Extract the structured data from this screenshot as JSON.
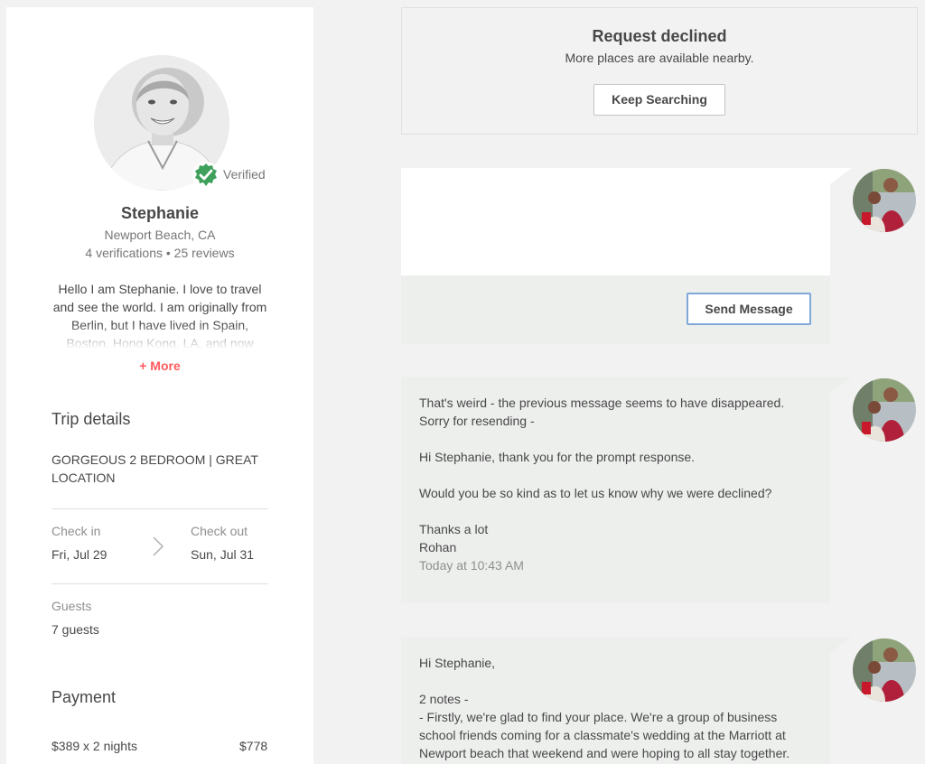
{
  "host": {
    "name": "Stephanie",
    "verified_label": "Verified",
    "location": "Newport Beach, CA",
    "stats": "4 verifications • 25 reviews",
    "bio": "Hello I am Stephanie. I love to travel and see the world. I am originally from Berlin, but I have lived in Spain, Boston, Hong Kong, LA, and now",
    "more_label": "+ More"
  },
  "trip": {
    "title": "Trip details",
    "listing_name": "GORGEOUS 2 BEDROOM | GREAT LOCATION",
    "checkin_label": "Check in",
    "checkin_value": "Fri, Jul 29",
    "checkout_label": "Check out",
    "checkout_value": "Sun, Jul 31",
    "guests_label": "Guests",
    "guests_value": "7 guests"
  },
  "payment": {
    "title": "Payment",
    "line_label": "$389 x 2 nights",
    "line_amount": "$778"
  },
  "status": {
    "title": "Request declined",
    "subtitle": "More places are available nearby.",
    "button_label": "Keep Searching"
  },
  "compose": {
    "value": "",
    "send_label": "Send Message"
  },
  "messages": [
    {
      "lines": [
        "That's weird - the previous message seems to have disappeared.",
        "Sorry for resending -",
        "",
        "Hi Stephanie, thank you for the prompt response.",
        "",
        "Would you be so kind as to let us know why we were declined?",
        "",
        "Thanks a lot",
        "Rohan"
      ],
      "time": "Today at 10:43 AM"
    },
    {
      "lines": [
        "Hi Stephanie,",
        "",
        "2 notes -",
        "- Firstly, we're glad to find your place. We're a group of business",
        "school friends coming for a classmate's wedding at the Marriott at",
        "Newport beach that weekend and were hoping to all stay together."
      ]
    }
  ],
  "colors": {
    "accent": "#ff5a5f",
    "verified_green": "#3fa05c",
    "send_border": "#7fa8d8",
    "message_bg": "#edefed"
  },
  "icons": {
    "verified": "check-badge-icon",
    "chevron": "chevron-right-icon"
  }
}
